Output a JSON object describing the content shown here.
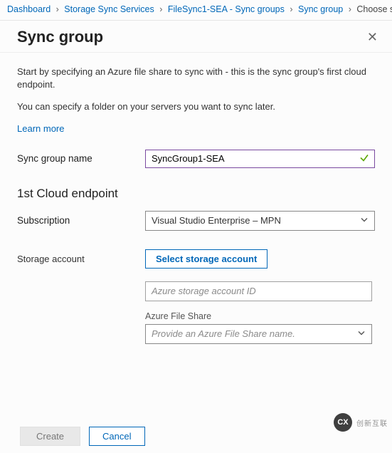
{
  "breadcrumb": {
    "c1": "Dashboard",
    "c2": "Storage Sync Services",
    "c3": "FileSync1-SEA - Sync groups",
    "c4": "Sync group",
    "c5": "Choose st"
  },
  "header": {
    "title": "Sync group"
  },
  "intro": {
    "line1": "Start by specifying an Azure file share to sync with - this is the sync group's first cloud endpoint.",
    "line2": "You can specify a folder on your servers you want to sync later.",
    "learn_more": "Learn more"
  },
  "form": {
    "sync_group_name_label": "Sync group name",
    "sync_group_name_value": "SyncGroup1-SEA",
    "first_cloud_title": "1st Cloud endpoint",
    "subscription_label": "Subscription",
    "subscription_value": "Visual Studio Enterprise – MPN",
    "storage_account_label": "Storage account",
    "select_storage_button": "Select storage account",
    "storage_account_placeholder": "Azure storage account ID",
    "afs_label": "Azure File Share",
    "afs_placeholder": "Provide an Azure File Share name."
  },
  "footer": {
    "create": "Create",
    "cancel": "Cancel"
  },
  "watermark": {
    "badge": "CX",
    "text": "创新互联"
  }
}
